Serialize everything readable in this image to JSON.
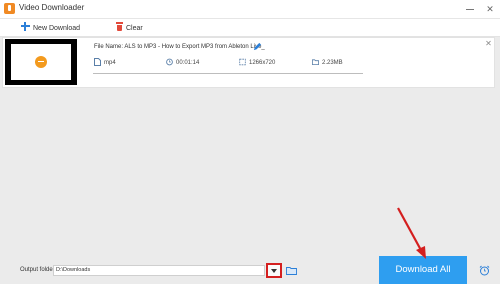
{
  "window": {
    "title": "Video Downloader"
  },
  "toolbar": {
    "new_download_label": "New Download",
    "clear_label": "Clear"
  },
  "item": {
    "filename": "File Name: ALS to MP3 - How to Export MP3 from Ableton Live_",
    "format": "mp4",
    "duration": "00:01:14",
    "resolution": "1266x720",
    "size": "2.23MB"
  },
  "bottom": {
    "output_folder_label": "Output folder:",
    "output_path": "D:\\Downloads",
    "download_all_label": "Download All"
  },
  "colors": {
    "accent": "#2e9ef0",
    "highlight_box": "#d41f1f",
    "annotation_arrow": "#d41f1f",
    "app_icon": "#f08a24"
  },
  "icons": [
    "app-icon",
    "plus-icon",
    "trash-icon",
    "play-icon",
    "pencil-icon",
    "file-icon",
    "clock-icon",
    "resolution-icon",
    "folder-size-icon",
    "close-icon",
    "chevron-down-icon",
    "folder-icon",
    "alarm-icon"
  ]
}
